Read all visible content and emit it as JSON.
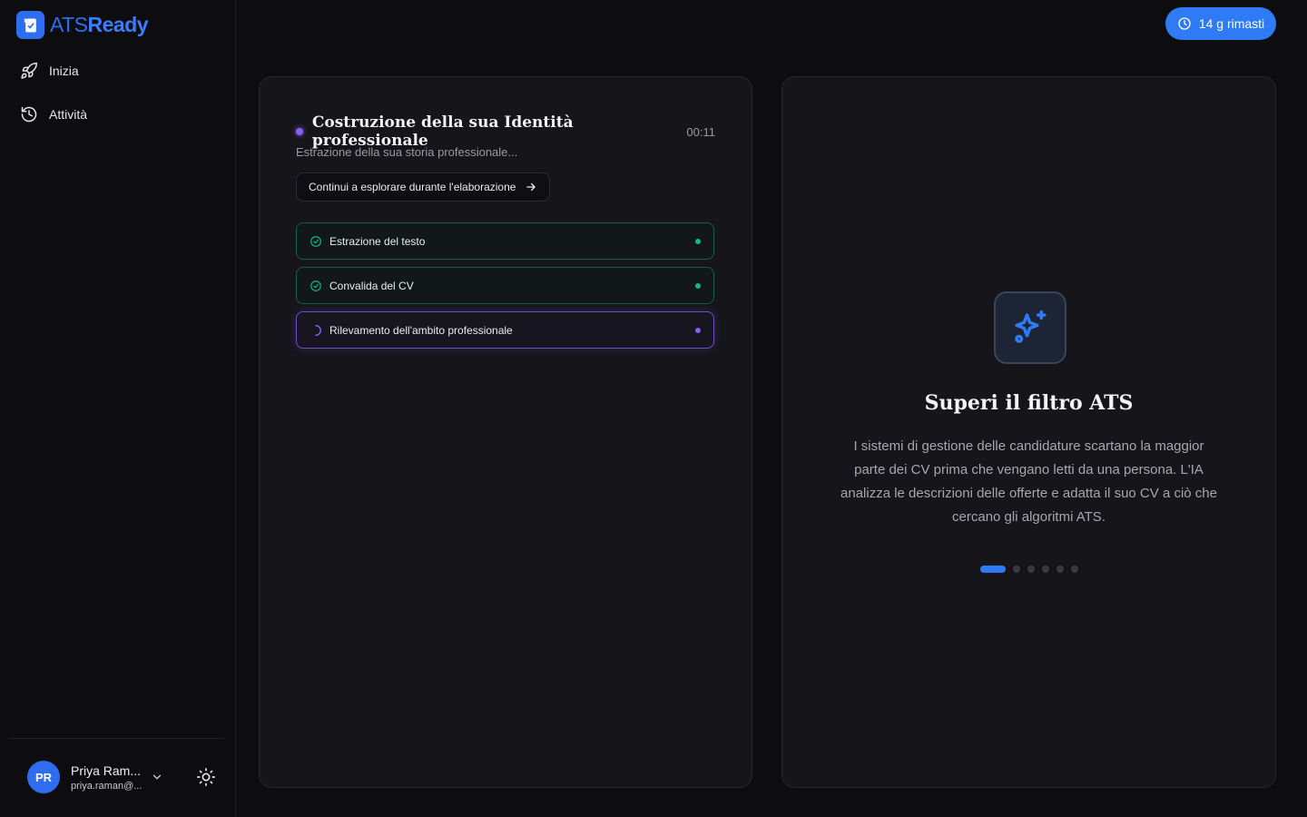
{
  "app": {
    "logo_text_a": "ATS",
    "logo_text_b": "Ready"
  },
  "sidebar": {
    "items": [
      {
        "label": "Inizia",
        "icon": "rocket-icon"
      },
      {
        "label": "Attività",
        "icon": "history-icon"
      }
    ]
  },
  "user": {
    "initials": "PR",
    "name": "Priya Ram...",
    "email": "priya.raman@..."
  },
  "header": {
    "trial_label": "14 g rimasti"
  },
  "processing": {
    "title": "Costruzione della sua Identità professionale",
    "timer": "00:11",
    "subtitle": "Estrazione della sua storia professionale...",
    "explore_label": "Continui a esplorare durante l'elaborazione",
    "steps": [
      {
        "label": "Estrazione del testo",
        "status": "done"
      },
      {
        "label": "Convalida del CV",
        "status": "done"
      },
      {
        "label": "Rilevamento dell'ambito professionale",
        "status": "active"
      }
    ]
  },
  "feature": {
    "title": "Superi il filtro ATS",
    "description": "I sistemi di gestione delle candidature scartano la maggior parte dei CV prima che vengano letti da una persona. L'IA analizza le descrizioni delle offerte e adatta il suo CV a ciò che cercano gli algoritmi ATS.",
    "slide_count": 6,
    "active_slide": 0
  },
  "colors": {
    "accent": "#2f7bf5",
    "success": "#10b981",
    "processing": "#8b5cf6",
    "background": "#0d0d10",
    "panel": "#15151a"
  }
}
